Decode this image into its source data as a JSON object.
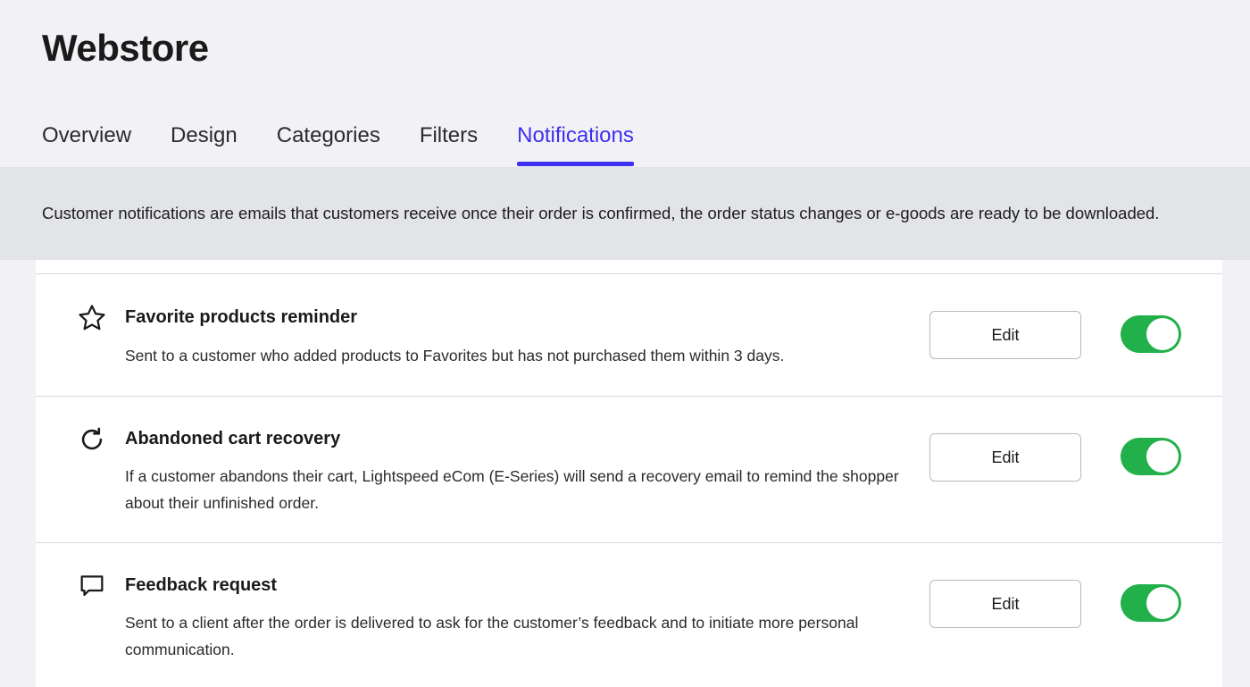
{
  "header": {
    "title": "Webstore"
  },
  "tabs": [
    {
      "label": "Overview",
      "active": false
    },
    {
      "label": "Design",
      "active": false
    },
    {
      "label": "Categories",
      "active": false
    },
    {
      "label": "Filters",
      "active": false
    },
    {
      "label": "Notifications",
      "active": true
    }
  ],
  "banner": {
    "text": "Customer notifications are emails that customers receive once their order is confirmed, the order status changes or e-goods are ready to be downloaded."
  },
  "notifications": [
    {
      "icon": "star-icon",
      "title": "Favorite products reminder",
      "description": "Sent to a customer who added products to Favorites but has not purchased them within 3 days.",
      "edit_label": "Edit",
      "enabled": true
    },
    {
      "icon": "refresh-icon",
      "title": "Abandoned cart recovery",
      "description": "If a customer abandons their cart, Lightspeed eCom (E-Series) will send a recovery email to remind the shopper about their unfinished order.",
      "edit_label": "Edit",
      "enabled": true
    },
    {
      "icon": "chat-bubble-icon",
      "title": "Feedback request",
      "description": "Sent to a client after the order is delivered to ask for the customer’s feedback and to initiate more personal communication.",
      "edit_label": "Edit",
      "enabled": true
    }
  ],
  "colors": {
    "accent": "#3d2ef0",
    "toggle_on": "#22b04a",
    "banner_bg": "#e3e4e8",
    "page_bg": "#f2f2f6"
  }
}
